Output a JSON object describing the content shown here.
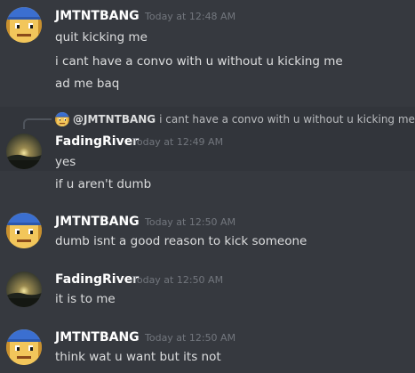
{
  "colors": {
    "background": "#36393f",
    "highlight": "#32353b",
    "username": "#ffffff",
    "timestamp": "#72767d",
    "text": "#dcddde"
  },
  "messages": [
    {
      "author": "JMTNTBANG",
      "avatar": "pixel-face-avatar",
      "timestamp": "Today at 12:48 AM",
      "lines": [
        "quit kicking me",
        "i cant have a convo with u without u kicking me",
        "ad me baq"
      ]
    },
    {
      "author": "FadingRiver",
      "avatar": "sunset-avatar",
      "timestamp": "Today at 12:49 AM",
      "reply_to": {
        "author": "@JMTNTBANG",
        "text": "i cant have a convo with u without u kicking me"
      },
      "lines": [
        "yes",
        "if u aren't dumb"
      ]
    },
    {
      "author": "JMTNTBANG",
      "avatar": "pixel-face-avatar",
      "timestamp": "Today at 12:50 AM",
      "lines": [
        "dumb isnt a good reason to kick someone"
      ]
    },
    {
      "author": "FadingRiver",
      "avatar": "sunset-avatar",
      "timestamp": "Today at 12:50 AM",
      "lines": [
        "it is to me"
      ]
    },
    {
      "author": "JMTNTBANG",
      "avatar": "pixel-face-avatar",
      "timestamp": "Today at 12:50 AM",
      "lines": [
        "think wat u want but its not"
      ]
    }
  ]
}
